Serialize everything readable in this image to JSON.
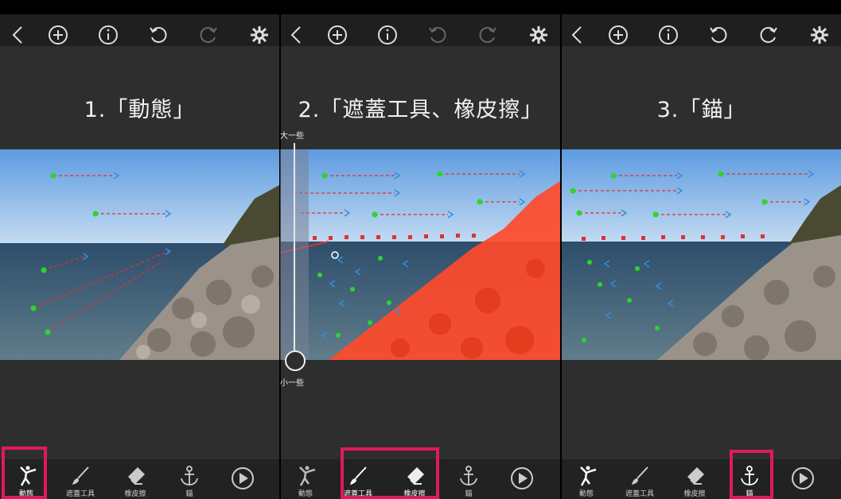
{
  "panels": [
    {
      "caption": "1.「動態」",
      "tabs": [
        {
          "label": "動態",
          "icon": "dancer-icon",
          "active": true
        },
        {
          "label": "遮蓋工具",
          "icon": "brush-icon"
        },
        {
          "label": "橡皮擦",
          "icon": "eraser-icon"
        },
        {
          "label": "錨",
          "icon": "anchor-icon"
        },
        {
          "label": "",
          "icon": "play-icon"
        }
      ]
    },
    {
      "caption": "2.「遮蓋工具、橡皮擦」",
      "tabs": [
        {
          "label": "動態",
          "icon": "dancer-icon"
        },
        {
          "label": "遮蓋工具",
          "icon": "brush-icon",
          "active": true
        },
        {
          "label": "橡皮擦",
          "icon": "eraser-icon",
          "active": true
        },
        {
          "label": "錨",
          "icon": "anchor-icon"
        },
        {
          "label": "",
          "icon": "play-icon"
        }
      ],
      "slider": {
        "top_label": "大一些",
        "bottom_label": "小一些"
      }
    },
    {
      "caption": "3.「錨」",
      "tabs": [
        {
          "label": "動態",
          "icon": "dancer-icon"
        },
        {
          "label": "遮蓋工具",
          "icon": "brush-icon"
        },
        {
          "label": "橡皮擦",
          "icon": "eraser-icon"
        },
        {
          "label": "錨",
          "icon": "anchor-icon",
          "active": true
        },
        {
          "label": "",
          "icon": "play-icon"
        }
      ]
    }
  ],
  "colors": {
    "highlight": "#e0195f",
    "mask": "#ff4a2a",
    "arrow_blue": "#2f8ee0",
    "arrow_red": "#e03030",
    "dot_green": "#2bd62b"
  }
}
